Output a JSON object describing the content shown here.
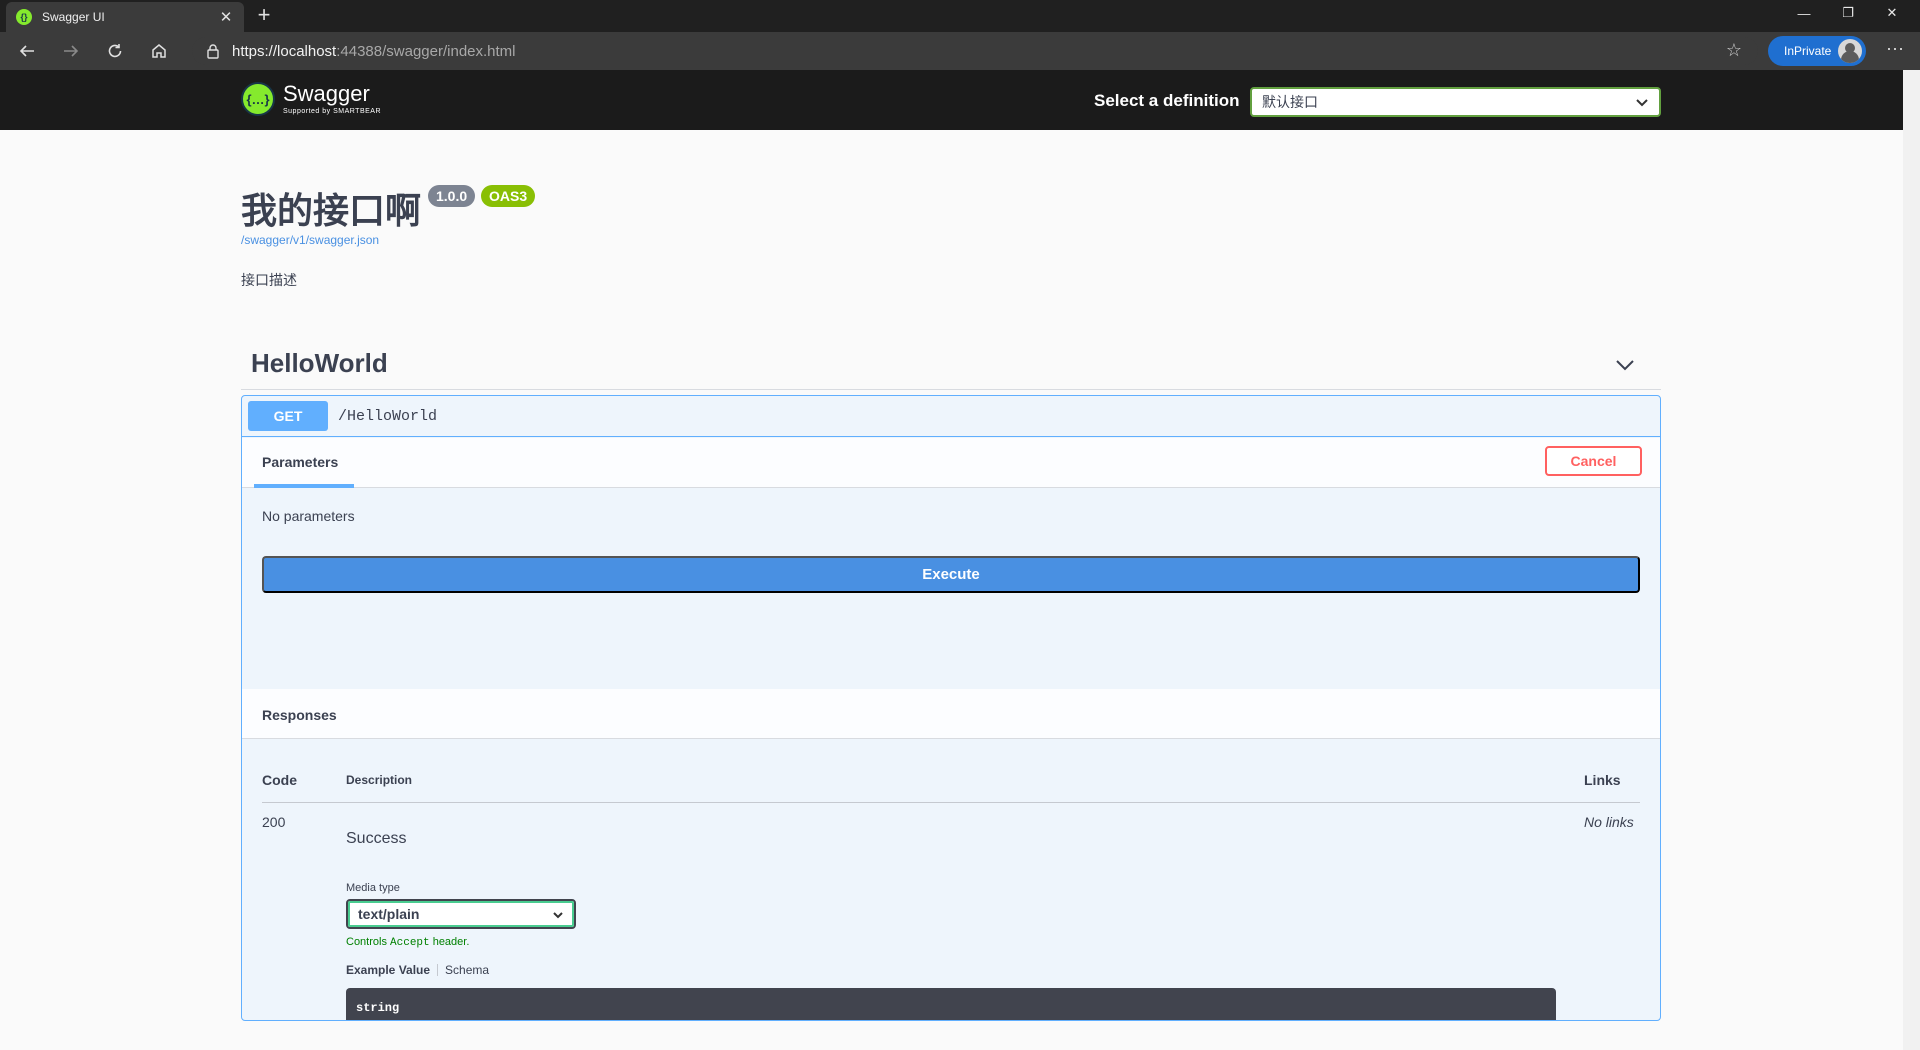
{
  "browser": {
    "tab_title": "Swagger UI",
    "url_base": "https://localhost",
    "url_rest": ":44388/swagger/index.html",
    "inprivate_label": "InPrivate"
  },
  "topbar": {
    "logo_name": "Swagger",
    "logo_sub": "Supported by SMARTBEAR",
    "definition_label": "Select a definition",
    "definition_value": "默认接口"
  },
  "info": {
    "title": "我的接口啊",
    "version": "1.0.0",
    "oas": "OAS3",
    "spec_url": "/swagger/v1/swagger.json",
    "description": "接口描述"
  },
  "tag": {
    "name": "HelloWorld"
  },
  "operation": {
    "method": "GET",
    "path": "/HelloWorld",
    "parameters_tab": "Parameters",
    "cancel_label": "Cancel",
    "no_parameters": "No parameters",
    "execute_label": "Execute",
    "responses_title": "Responses",
    "columns": {
      "code": "Code",
      "description": "Description",
      "links": "Links"
    },
    "responses": [
      {
        "code": "200",
        "description": "Success",
        "links": "No links",
        "media_type_label": "Media type",
        "media_type": "text/plain",
        "controls_note_pre": "Controls ",
        "controls_note_code": "Accept",
        "controls_note_post": " header.",
        "example_tab": "Example Value",
        "schema_tab": "Schema",
        "example": "string"
      }
    ]
  },
  "colors": {
    "get_method": "#61affe",
    "execute": "#4990e2",
    "cancel": "#ff6060",
    "swagger_green": "#85ea2d",
    "oas_badge": "#89bf04"
  }
}
